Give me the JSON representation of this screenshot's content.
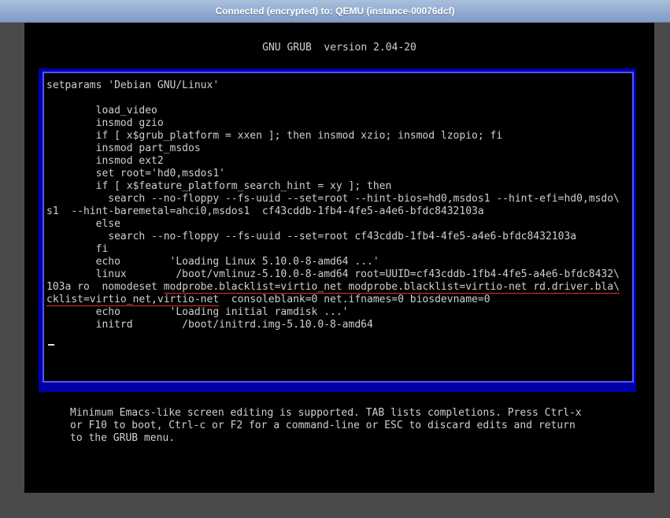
{
  "window": {
    "title": "Connected (encrypted) to: QEMU (instance-00076dcf)"
  },
  "grub": {
    "header": "GNU GRUB  version 2.04-20",
    "lines": [
      "setparams 'Debian GNU/Linux'",
      "",
      "        load_video",
      "        insmod gzio",
      "        if [ x$grub_platform = xxen ]; then insmod xzio; insmod lzopio; fi",
      "        insmod part_msdos",
      "        insmod ext2",
      "        set root='hd0,msdos1'",
      "        if [ x$feature_platform_search_hint = xy ]; then",
      "          search --no-floppy --fs-uuid --set=root --hint-bios=hd0,msdos1 --hint-efi=hd0,msdo\\",
      "s1  --hint-baremetal=ahci0,msdos1  cf43cddb-1fb4-4fe5-a4e6-bfdc8432103a",
      "        else",
      "          search --no-floppy --fs-uuid --set=root cf43cddb-1fb4-4fe5-a4e6-bfdc8432103a",
      "        fi",
      "        echo        'Loading Linux 5.10.0-8-amd64 ...'",
      "        linux        /boot/vmlinuz-5.10.0-8-amd64 root=UUID=cf43cddb-1fb4-4fe5-a4e6-bfdc8432\\"
    ],
    "line_ro_prefix": "103a ro  nomodeset ",
    "line_ro_highlight": "modprobe.blacklist=virtio_net modprobe.blacklist=virtio-net rd.driver.bla\\",
    "line_cont_highlight": "cklist=virtio_net,virtio-net",
    "line_cont_suffix": "  consoleblank=0 net.ifnames=0 biosdevname=0",
    "lines_after": [
      "        echo        'Loading initial ramdisk ...'",
      "        initrd        /boot/initrd.img-5.10.0-8-amd64"
    ],
    "help": [
      "Minimum Emacs-like screen editing is supported. TAB lists completions. Press Ctrl-x",
      "or F10 to boot, Ctrl-c or F2 for a command-line or ESC to discard edits and return",
      "to the GRUB menu."
    ]
  },
  "colors": {
    "frame_blue": "#0000aa",
    "border_blue": "#5555ff",
    "highlight_underline": "#e03030",
    "text": "#cfcfcf"
  }
}
